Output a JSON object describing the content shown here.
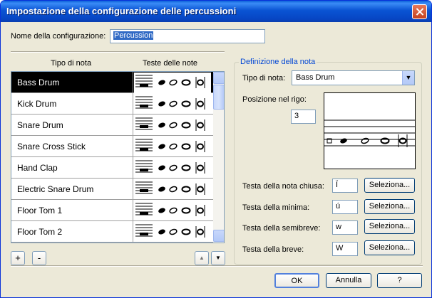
{
  "title": "Impostazione della configurazione delle percussioni",
  "config": {
    "label": "Nome della configurazione:",
    "value": "Percussion"
  },
  "list": {
    "col_type": "Tipo di nota",
    "col_heads": "Teste delle note",
    "rows": [
      {
        "name": "Bass Drum",
        "selected": true
      },
      {
        "name": "Kick Drum",
        "selected": false
      },
      {
        "name": "Snare Drum",
        "selected": false
      },
      {
        "name": "Snare Cross Stick",
        "selected": false
      },
      {
        "name": "Hand Clap",
        "selected": false
      },
      {
        "name": "Electric Snare Drum",
        "selected": false
      },
      {
        "name": "Floor Tom 1",
        "selected": false
      },
      {
        "name": "Floor Tom 2",
        "selected": false
      }
    ]
  },
  "list_buttons": {
    "add": "+",
    "remove": "-",
    "up": "▲",
    "down": "▼"
  },
  "definition": {
    "group_title": "Definizione della nota",
    "type_label": "Tipo di nota:",
    "type_value": "Bass Drum",
    "position_label": "Posizione nel rigo:",
    "position_value": "3",
    "closed_label": "Testa della nota chiusa:",
    "closed_value": "Ï",
    "minim_label": "Testa della minima:",
    "minim_value": "ú",
    "semibreve_label": "Testa della semibreve:",
    "semibreve_value": "w",
    "breve_label": "Testa della breve:",
    "breve_value": "W",
    "select_label": "Seleziona..."
  },
  "footer": {
    "ok": "OK",
    "cancel": "Annulla",
    "help": "?"
  }
}
